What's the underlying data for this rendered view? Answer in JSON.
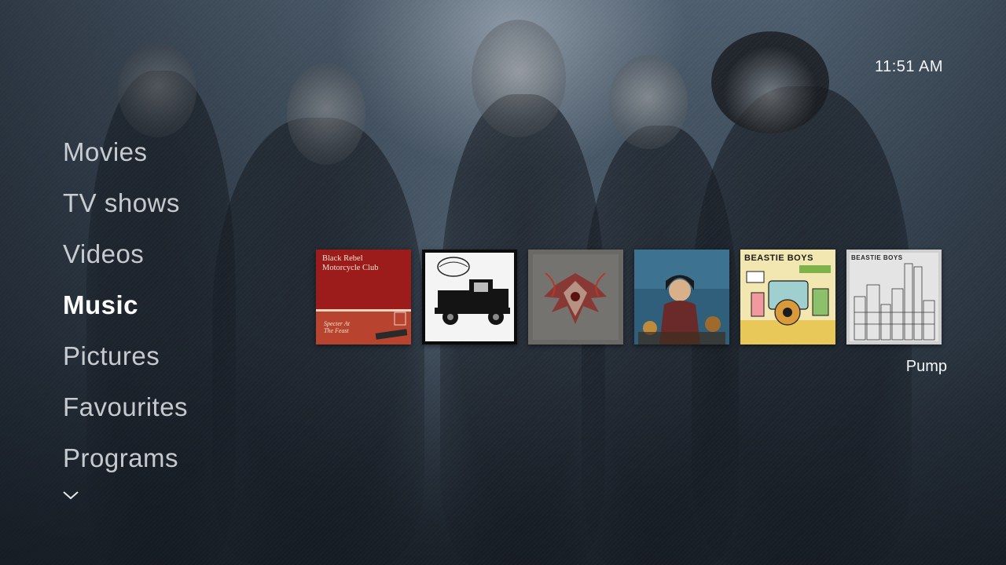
{
  "header": {
    "clock": "11:51 AM"
  },
  "main_menu": {
    "items": [
      {
        "label": "Movies"
      },
      {
        "label": "TV shows"
      },
      {
        "label": "Videos"
      },
      {
        "label": "Music",
        "active": true
      },
      {
        "label": "Pictures"
      },
      {
        "label": "Favourites"
      },
      {
        "label": "Programs"
      }
    ],
    "more_icon": "chevron-down-icon"
  },
  "music_shelf": {
    "albums": [
      {
        "artist_line_1": "Black Rebel",
        "artist_line_2": "Motorcycle Club",
        "album_line_1": "Specter At",
        "album_line_2": "The Feast",
        "colors": {
          "top": "#9c1c1c",
          "bottom": "#b23a2a"
        }
      },
      {
        "cover": "vintage-truck-cover",
        "colors": {
          "bg": "#ffffff",
          "ink": "#111111"
        }
      },
      {
        "cover": "symmetric-red-abstract-cover",
        "colors": {
          "bg": "#6a6966",
          "accent": "#a1302a"
        }
      },
      {
        "cover": "portrait-illustration-cover",
        "colors": {
          "bg": "#2f5f7a",
          "accent": "#c08a3c"
        }
      },
      {
        "title": "BEASTIE BOYS",
        "cover": "cartoon-machine-cover",
        "colors": {
          "bg": "#f2e7b0",
          "ink": "#1b1b1b"
        }
      },
      {
        "title": "BEASTIE BOYS",
        "cover": "city-skyline-sketch-cover",
        "colors": {
          "bg": "#cfcfcf",
          "ink": "#2a2a2a"
        }
      }
    ],
    "selected_title": "Pump"
  }
}
